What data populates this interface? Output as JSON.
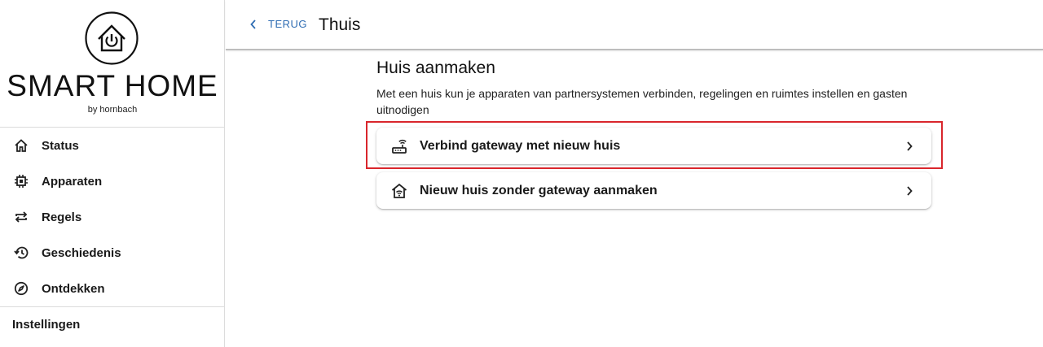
{
  "app": {
    "logo_title": "SMART HOME",
    "logo_subtitle": "by hornbach"
  },
  "sidebar": {
    "items": [
      {
        "label": "Status",
        "icon": "home-icon"
      },
      {
        "label": "Apparaten",
        "icon": "chip-icon"
      },
      {
        "label": "Regels",
        "icon": "repeat-icon"
      },
      {
        "label": "Geschiedenis",
        "icon": "history-icon"
      },
      {
        "label": "Ontdekken",
        "icon": "compass-icon"
      }
    ],
    "settings_label": "Instellingen"
  },
  "header": {
    "back_label": "TERUG",
    "title": "Thuis"
  },
  "main": {
    "title": "Huis aanmaken",
    "description": "Met een huis kun je apparaten van partnersystemen verbinden, regelingen en ruimtes instellen en gasten uitnodigen",
    "options": [
      {
        "label": "Verbind gateway met nieuw huis",
        "icon": "router-icon",
        "highlighted": true
      },
      {
        "label": "Nieuw huis zonder gateway aanmaken",
        "icon": "house-wifi-icon",
        "highlighted": false
      }
    ]
  },
  "colors": {
    "accent": "#2f6db3",
    "highlight": "#d9262c",
    "text": "#1a1a1a",
    "divider": "#dcdcdc"
  }
}
